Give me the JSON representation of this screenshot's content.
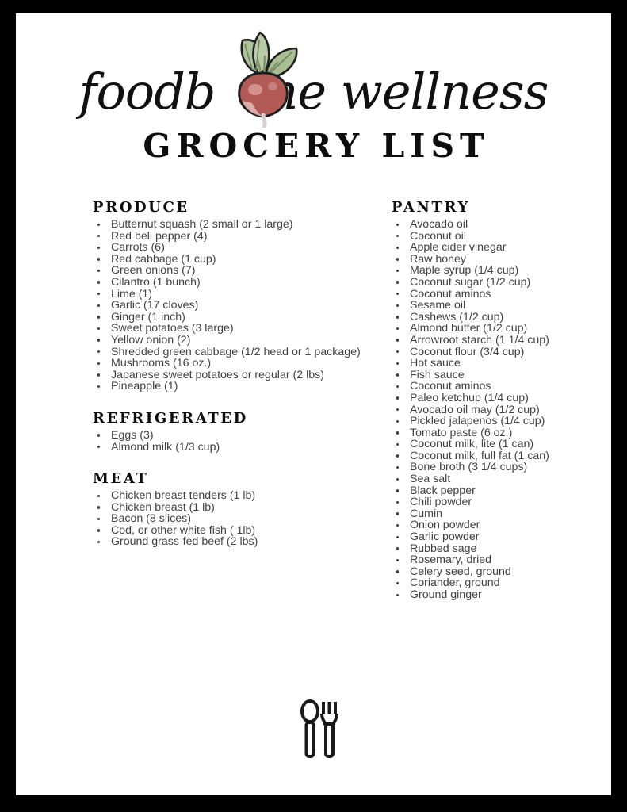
{
  "colors": {
    "border": "#000000",
    "page": "#ffffff",
    "ink": "#0d0d0d",
    "body_text": "#414141",
    "radish_bulb": "#b25a56",
    "radish_bulb_highlight": "#d99a96",
    "radish_leaf": "#a8bf95",
    "radish_outline": "#1a1a1a"
  },
  "masthead": {
    "brand_script": "foodborne wellness",
    "brand_word_1": "foodb",
    "brand_word_2": "rne wellness",
    "title": "GROCERY LIST",
    "logo_icon": "radish-icon"
  },
  "columns": {
    "left": [
      {
        "heading": "PRODUCE",
        "items": [
          "Butternut squash (2 small or 1 large)",
          "Red bell pepper (4)",
          "Carrots (6)",
          "Red cabbage (1 cup)",
          "Green onions (7)",
          "Cilantro (1 bunch)",
          "Lime (1)",
          "Garlic (17 cloves)",
          "Ginger (1 inch)",
          "Sweet potatoes (3 large)",
          "Yellow onion (2)",
          "Shredded green cabbage (1/2 head or 1 package)",
          "Mushrooms (16 oz.)",
          "Japanese sweet potatoes or regular (2 lbs)",
          "Pineapple (1)"
        ]
      },
      {
        "heading": "REFRIGERATED",
        "items": [
          "Eggs (3)",
          "Almond milk (1/3 cup)"
        ]
      },
      {
        "heading": "MEAT",
        "items": [
          "Chicken breast tenders (1 lb)",
          "Chicken breast (1 lb)",
          "Bacon (8 slices)",
          "Cod, or other white fish ( 1lb)",
          "Ground grass-fed beef (2 lbs)"
        ]
      }
    ],
    "right": [
      {
        "heading": "PANTRY",
        "items": [
          "Avocado oil",
          "Coconut oil",
          "Apple cider vinegar",
          "Raw honey",
          "Maple syrup (1/4 cup)",
          "Coconut sugar (1/2 cup)",
          "Coconut aminos",
          "Sesame oil",
          "Cashews (1/2 cup)",
          "Almond butter (1/2 cup)",
          "Arrowroot starch (1 1/4 cup)",
          "Coconut flour (3/4 cup)",
          "Hot sauce",
          "Fish sauce",
          "Coconut aminos",
          "Paleo ketchup (1/4 cup)",
          "Avocado oil may (1/2 cup)",
          "Pickled jalapenos (1/4 cup)",
          "Tomato paste (6 oz.)",
          "Coconut milk, lite (1 can)",
          "Coconut milk, full fat (1 can)",
          "Bone broth (3 1/4 cups)",
          "Sea salt",
          "Black pepper",
          "Chili powder",
          "Cumin",
          "Onion powder",
          "Garlic powder",
          "Rubbed sage",
          "Rosemary, dried",
          "Celery seed, ground",
          "Coriander, ground",
          "Ground ginger"
        ]
      }
    ]
  },
  "footer": {
    "icon": "spoon-and-fork-icon"
  }
}
